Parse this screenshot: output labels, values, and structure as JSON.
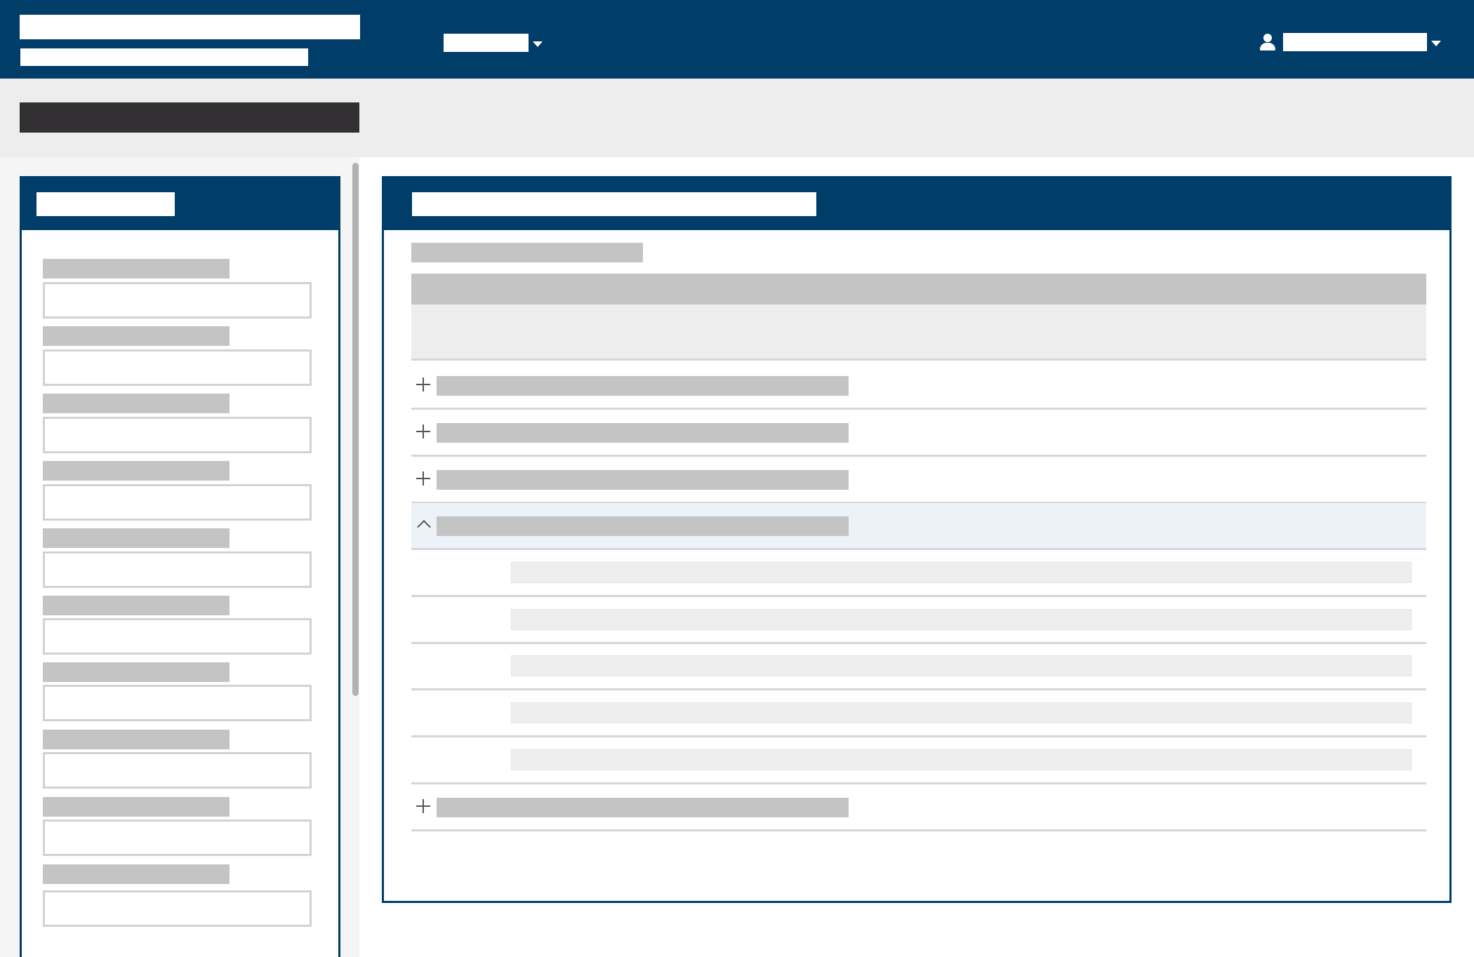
{
  "header": {
    "app_title": "",
    "app_subtitle": "",
    "nav_menu_label": "",
    "user_name": "",
    "icons": {
      "user": "user-icon",
      "dropdown": "chevron-down-icon"
    }
  },
  "page": {
    "title": ""
  },
  "filter_panel": {
    "title": "",
    "fields": [
      {
        "label": "",
        "value": ""
      },
      {
        "label": "",
        "value": ""
      },
      {
        "label": "",
        "value": ""
      },
      {
        "label": "",
        "value": ""
      },
      {
        "label": "",
        "value": ""
      },
      {
        "label": "",
        "value": ""
      },
      {
        "label": "",
        "value": ""
      },
      {
        "label": "",
        "value": ""
      },
      {
        "label": "",
        "value": ""
      },
      {
        "label": "",
        "value": ""
      }
    ]
  },
  "main_panel": {
    "title": "",
    "section_label": "",
    "table_header": "",
    "table_subheader": "",
    "groups": [
      {
        "label": "",
        "state": "collapsed",
        "icon": "plus-icon"
      },
      {
        "label": "",
        "state": "collapsed",
        "icon": "plus-icon"
      },
      {
        "label": "",
        "state": "collapsed",
        "icon": "plus-icon"
      },
      {
        "label": "",
        "state": "expanded",
        "icon": "chevron-up-icon",
        "children": [
          "",
          "",
          "",
          "",
          ""
        ]
      },
      {
        "label": "",
        "state": "collapsed",
        "icon": "plus-icon"
      }
    ]
  },
  "colors": {
    "brand": "#003e69",
    "band": "#ededed",
    "page_title_block": "#333033",
    "placeholder_text": "#c4c4c4",
    "expanded_row": "#edf1f8",
    "divider": "#d6d6d6"
  }
}
